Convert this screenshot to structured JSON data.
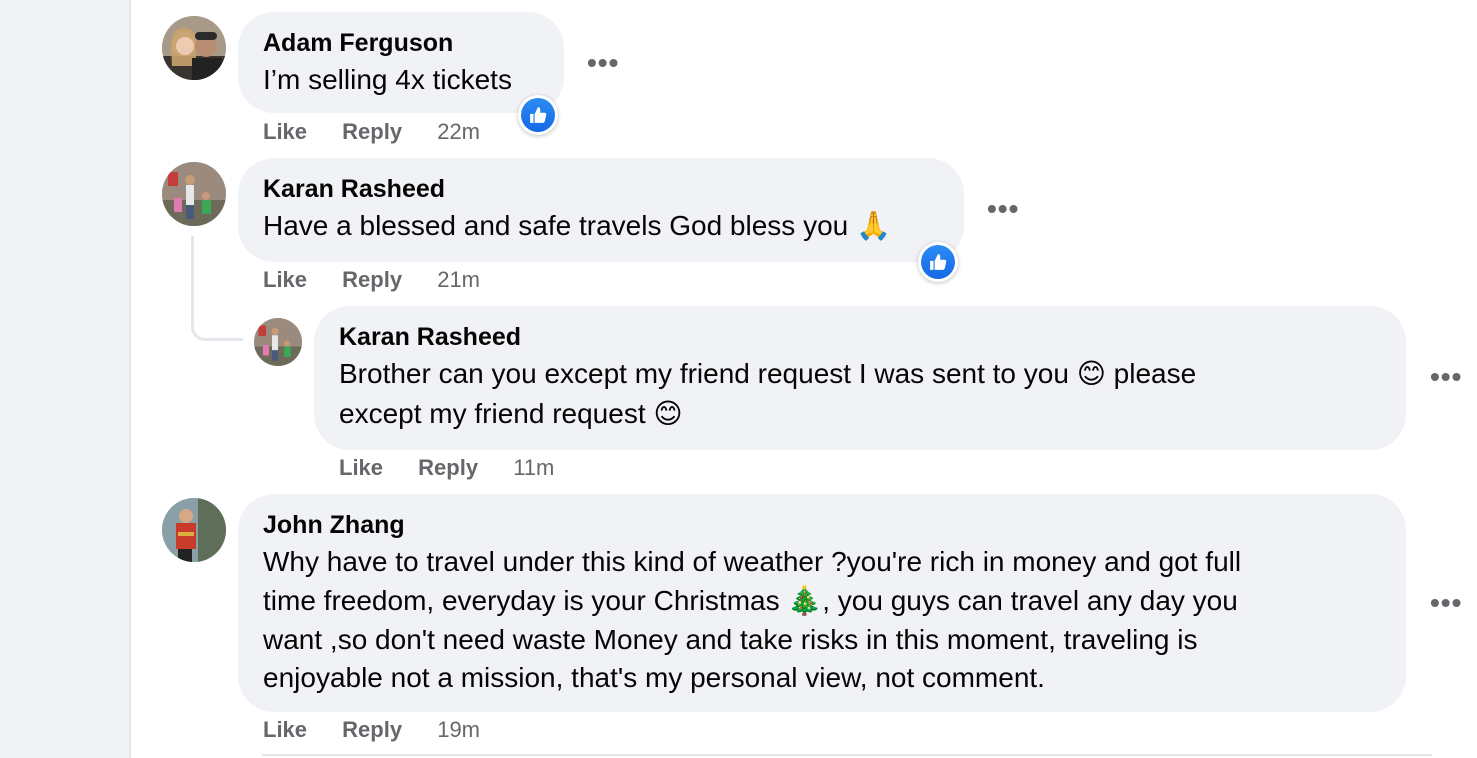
{
  "comments": [
    {
      "author": "Adam Ferguson",
      "text": "I’m selling 4x tickets",
      "like_label": "Like",
      "reply_label": "Reply",
      "time": "22m",
      "more": "•••",
      "reaction": "like-icon"
    },
    {
      "author": "Karan Rasheed",
      "text": "Have a blessed and safe travels God bless you 🙏",
      "like_label": "Like",
      "reply_label": "Reply",
      "time": "21m",
      "more": "•••",
      "reaction": "like-icon"
    },
    {
      "author": "Karan Rasheed",
      "text_line1": "Brother can you except my friend request I was sent to you 😊 please",
      "text_line2": "except my friend request 😊",
      "like_label": "Like",
      "reply_label": "Reply",
      "time": "11m",
      "more": "•••"
    },
    {
      "author": "John Zhang",
      "text_line1": "Why have to travel under this kind of weather ?you're rich in money and got full",
      "text_line2": "time freedom, everyday is your Christmas 🎄, you guys can travel any day you",
      "text_line3": "want ,so don't need waste Money and take risks in this moment, traveling is",
      "text_line4": "enjoyable not a mission, that's my personal view, not comment.",
      "like_label": "Like",
      "reply_label": "Reply",
      "time": "19m",
      "more": "•••"
    }
  ],
  "colors": {
    "bubble": "#f0f2f5",
    "secondary_text": "#65676b",
    "like_blue": "#1877f2"
  }
}
